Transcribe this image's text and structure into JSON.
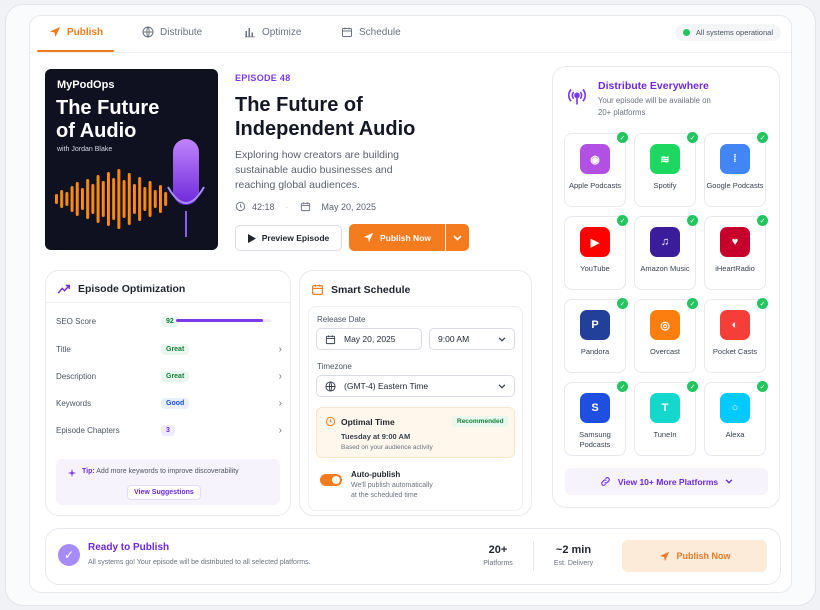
{
  "nav": {
    "tabs": [
      {
        "label": "Publish",
        "icon": "send-icon"
      },
      {
        "label": "Distribute",
        "icon": "globe-icon"
      },
      {
        "label": "Optimize",
        "icon": "bar-chart-icon"
      },
      {
        "label": "Schedule",
        "icon": "calendar-icon"
      }
    ],
    "active_tab": "Publish",
    "status": "All systems operational"
  },
  "cover": {
    "brand": "MyPodOps",
    "title_line1": "The Future",
    "title_line2": "of Audio",
    "subtitle": "with Jordan Blake"
  },
  "episode": {
    "label": "EPISODE 48",
    "title": "The Future of Independent Audio",
    "description": "Exploring how creators are building sustainable audio businesses and reaching global audiences.",
    "duration": "42:18",
    "date": "May 20, 2025",
    "preview_label": "Preview Episode",
    "publish_label": "Publish Now"
  },
  "optimization": {
    "title": "Episode Optimization",
    "rows": [
      {
        "label": "SEO Score",
        "value": "92",
        "style": "green"
      },
      {
        "label": "Title",
        "value": "Great",
        "style": "green"
      },
      {
        "label": "Description",
        "value": "Great",
        "style": "green"
      },
      {
        "label": "Keywords",
        "value": "Good",
        "style": "blue"
      },
      {
        "label": "Episode Chapters",
        "value": "3",
        "style": "purple"
      }
    ],
    "seo_progress": 0.92,
    "tip_prefix": "Tip:",
    "tip_text": "Add more keywords to improve discoverability",
    "tip_button": "View Suggestions"
  },
  "schedule": {
    "title": "Smart Schedule",
    "release_label": "Release Date",
    "release_date": "May 20, 2025",
    "release_time": "9:00 AM",
    "timezone_label": "Timezone",
    "timezone": "(GMT-4) Eastern Time",
    "optimal_title": "Optimal Time",
    "optimal_badge": "Recommended",
    "optimal_time": "Tuesday at 9:00 AM",
    "optimal_note": "Based on your audience activity",
    "auto_title": "Auto-publish",
    "auto_line1": "We'll publish automatically",
    "auto_line2": "at the scheduled time",
    "auto_enabled": true
  },
  "distribute": {
    "title": "Distribute Everywhere",
    "subtitle_line1": "Your episode will be available on",
    "subtitle_line2": "20+ platforms",
    "platforms": [
      {
        "name": "Apple Podcasts",
        "icon": "apple-podcasts-icon",
        "color": "#b150e2"
      },
      {
        "name": "Spotify",
        "icon": "spotify-icon",
        "color": "#1ed760"
      },
      {
        "name": "Google Podcasts",
        "icon": "google-podcasts-icon",
        "color": "#4285f4"
      },
      {
        "name": "YouTube",
        "icon": "youtube-icon",
        "color": "#ff0000"
      },
      {
        "name": "Amazon Music",
        "icon": "amazon-music-icon",
        "color": "#3b1d9b"
      },
      {
        "name": "iHeartRadio",
        "icon": "iheartradio-icon",
        "color": "#c6002b"
      },
      {
        "name": "Pandora",
        "icon": "pandora-icon",
        "color": "#224099"
      },
      {
        "name": "Overcast",
        "icon": "overcast-icon",
        "color": "#fc7e0f"
      },
      {
        "name": "Pocket Casts",
        "icon": "pocket-casts-icon",
        "color": "#f43e37"
      },
      {
        "name": "Samsung Podcasts",
        "icon": "samsung-podcasts-icon",
        "color": "#1f4fe0"
      },
      {
        "name": "TuneIn",
        "icon": "tunein-icon",
        "color": "#14d8cc"
      },
      {
        "name": "Alexa",
        "icon": "alexa-icon",
        "color": "#00caff"
      }
    ],
    "more_label": "View 10+ More Platforms"
  },
  "footer": {
    "title": "Ready to Publish",
    "subtitle": "All systems go! Your episode will be distributed to all selected platforms.",
    "stat1_value": "20+",
    "stat1_label": "Platforms",
    "stat2_value": "~2 min",
    "stat2_label": "Est. Delivery",
    "button": "Publish Now"
  },
  "colors": {
    "accent": "#f57b1f",
    "purple": "#7c3aed",
    "success": "#22c55e"
  }
}
